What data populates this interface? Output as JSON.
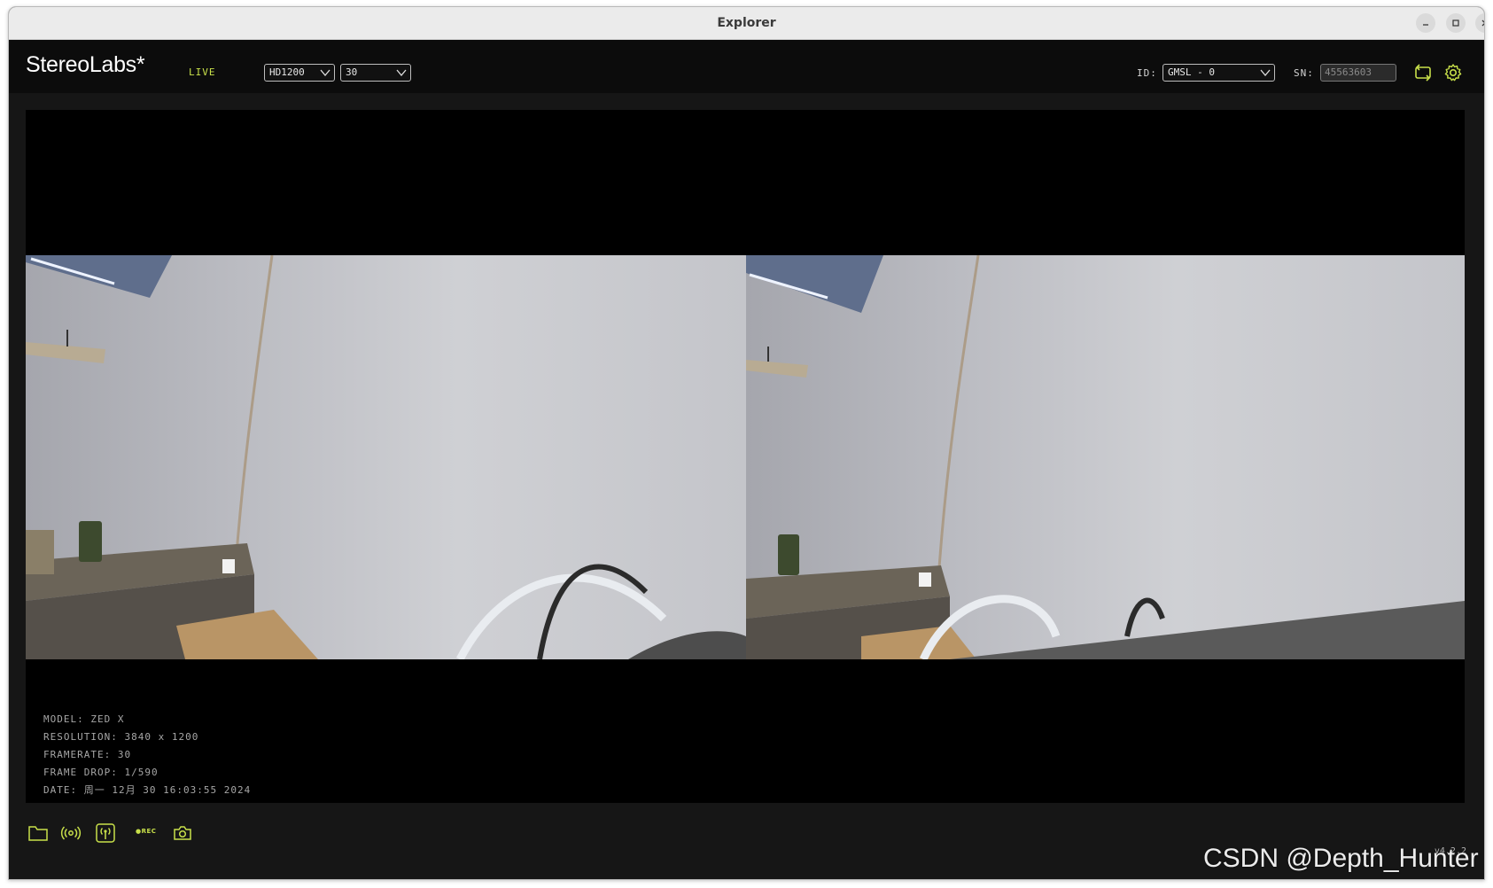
{
  "window": {
    "title": "Explorer"
  },
  "appbar": {
    "logo": "StereoLabs*",
    "status": "LIVE",
    "resolution_select": "HD1200",
    "fps_select": "30",
    "id_label": "ID:",
    "id_select": "GMSL - 0",
    "sn_label": "SN:",
    "sn_value": "45563603"
  },
  "info": {
    "model": "MODEL: ZED X",
    "resolution": "RESOLUTION: 3840 x 1200",
    "framerate": "FRAMERATE: 30",
    "frame_drop": "FRAME DROP: 1/590",
    "date": "DATE: 周一 12月 30 16:03:55 2024"
  },
  "bottombar": {
    "rec_label": "●REC",
    "version": "v4.2.2"
  },
  "watermark": "CSDN @Depth_Hunter",
  "colors": {
    "accent": "#c8e04a",
    "background": "#161616",
    "viewer": "#000000"
  },
  "icons": [
    "folder-icon",
    "stream-icon",
    "broadcast-icon",
    "record-icon",
    "camera-icon",
    "refresh-icon",
    "gear-icon"
  ]
}
